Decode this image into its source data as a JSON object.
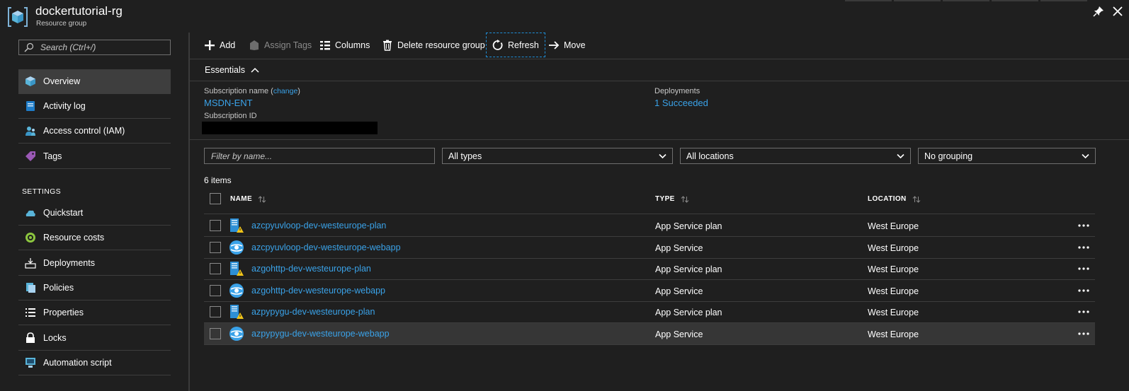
{
  "header": {
    "title": "dockertutorial-rg",
    "subtitle": "Resource group",
    "icons": [
      "resource-group-icon",
      "pin-icon",
      "close-icon"
    ]
  },
  "sidebar": {
    "search_placeholder": "Search (Ctrl+/)",
    "items": [
      {
        "label": "Overview",
        "icon": "overview-icon",
        "active": true
      },
      {
        "label": "Activity log",
        "icon": "activity-log-icon"
      },
      {
        "label": "Access control (IAM)",
        "icon": "iam-icon"
      },
      {
        "label": "Tags",
        "icon": "tag-icon"
      }
    ],
    "section_title": "SETTINGS",
    "settings_items": [
      {
        "label": "Quickstart",
        "icon": "quickstart-icon"
      },
      {
        "label": "Resource costs",
        "icon": "resource-costs-icon"
      },
      {
        "label": "Deployments",
        "icon": "deployments-icon"
      },
      {
        "label": "Policies",
        "icon": "policies-icon"
      },
      {
        "label": "Properties",
        "icon": "properties-icon"
      },
      {
        "label": "Locks",
        "icon": "lock-icon"
      },
      {
        "label": "Automation script",
        "icon": "automation-script-icon"
      }
    ]
  },
  "toolbar": {
    "add": "Add",
    "assign_tags": "Assign Tags",
    "columns": "Columns",
    "delete": "Delete resource group",
    "refresh": "Refresh",
    "move": "Move"
  },
  "essentials": {
    "title": "Essentials",
    "subscription_name_label": "Subscription name",
    "change_link": "change",
    "subscription_name": "MSDN-ENT",
    "subscription_id_label": "Subscription ID",
    "deployments_label": "Deployments",
    "deployments_value": "1 Succeeded"
  },
  "filters": {
    "name_placeholder": "Filter by name...",
    "types": "All types",
    "locations": "All locations",
    "grouping": "No grouping"
  },
  "table": {
    "count": "6 items",
    "columns": {
      "name": "NAME",
      "type": "TYPE",
      "location": "LOCATION"
    },
    "rows": [
      {
        "name": "azcpyuvloop-dev-westeurope-plan",
        "type": "App Service plan",
        "location": "West Europe",
        "icon": "app-service-plan-icon"
      },
      {
        "name": "azcpyuvloop-dev-westeurope-webapp",
        "type": "App Service",
        "location": "West Europe",
        "icon": "app-service-icon"
      },
      {
        "name": "azgohttp-dev-westeurope-plan",
        "type": "App Service plan",
        "location": "West Europe",
        "icon": "app-service-plan-icon"
      },
      {
        "name": "azgohttp-dev-westeurope-webapp",
        "type": "App Service",
        "location": "West Europe",
        "icon": "app-service-icon"
      },
      {
        "name": "azpypygu-dev-westeurope-plan",
        "type": "App Service plan",
        "location": "West Europe",
        "icon": "app-service-plan-icon"
      },
      {
        "name": "azpypygu-dev-westeurope-webapp",
        "type": "App Service",
        "location": "West Europe",
        "icon": "app-service-icon",
        "selected": true
      }
    ]
  },
  "colors": {
    "background": "#1f1f1f",
    "link": "#3aa2e8",
    "selected_row": "#363636",
    "active_nav": "#3e3e3e"
  }
}
